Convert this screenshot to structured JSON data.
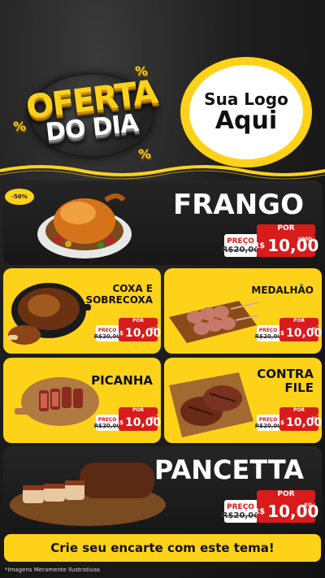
{
  "header": {
    "badge_line1": "OFERTA",
    "badge_line2": "DO DIA",
    "percent_symbol": "%",
    "logo_line1": "Sua Logo",
    "logo_line2": "Aqui"
  },
  "products": {
    "frango": {
      "name": "FRANGO",
      "discount": "-50%",
      "por": "POR",
      "preco": "PREÇO",
      "old": "R$20,00",
      "currency": "R$",
      "price": "10,00",
      "unit": "UNID"
    },
    "coxa": {
      "name_line1": "COXA E",
      "name_line2": "SOBRECOXA",
      "por": "POR",
      "preco": "PREÇO",
      "old": "R$20,00",
      "currency": "R$",
      "price": "10,00",
      "unit": "KG"
    },
    "medalhao": {
      "name": "MEDALHÃO",
      "por": "POR",
      "preco": "PREÇO",
      "old": "R$20,00",
      "currency": "R$",
      "price": "10,00",
      "unit": "KG"
    },
    "picanha": {
      "name": "PICANHA",
      "por": "POR",
      "preco": "PREÇO",
      "old": "R$20,00",
      "currency": "R$",
      "price": "10,00",
      "unit": "KG"
    },
    "contrafile": {
      "name_line1": "CONTRA",
      "name_line2": "FILE",
      "por": "POR",
      "preco": "PREÇO",
      "old": "R$20,00",
      "currency": "R$",
      "price": "10,00",
      "unit": "KG"
    },
    "pancetta": {
      "name": "PANCETTA",
      "por": "POR",
      "preco": "PREÇO",
      "old": "R$20,00",
      "currency": "R$",
      "price": "10,00",
      "unit": "KG"
    }
  },
  "cta": "Crie seu encarte com este tema!",
  "footnote": "*Imagens Meramente Ilustrativas",
  "colors": {
    "accent": "#ffd21a",
    "price_red": "#d81b1b",
    "dark": "#1c1c1c"
  }
}
